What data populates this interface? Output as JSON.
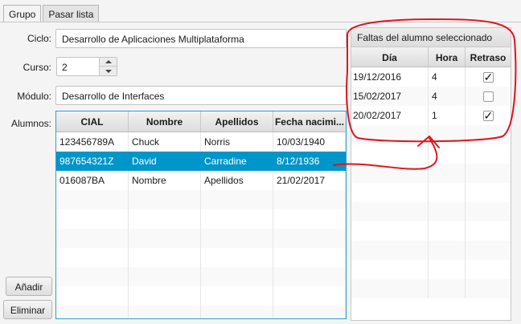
{
  "tabs": [
    {
      "label": "Grupo",
      "active": true
    },
    {
      "label": "Pasar lista",
      "active": false
    }
  ],
  "form": {
    "ciclo_label": "Ciclo:",
    "ciclo_value": "Desarrollo de Aplicaciones Multiplataforma",
    "curso_label": "Curso:",
    "curso_value": "2",
    "modulo_label": "Módulo:",
    "modulo_value": "Desarrollo de Interfaces",
    "alumnos_label": "Alumnos:"
  },
  "buttons": {
    "add": "Añadir",
    "delete": "Eliminar"
  },
  "alumnos_table": {
    "columns": [
      "CIAL",
      "Nombre",
      "Apellidos",
      "Fecha nacimi..."
    ],
    "rows": [
      [
        "123456789A",
        "Chuck",
        "Norris",
        "10/03/1940"
      ],
      [
        "987654321Z",
        "David",
        "Carradine",
        "8/12/1936"
      ],
      [
        "016087BA",
        "Nombre",
        "Apellidos",
        "21/02/2017"
      ]
    ],
    "selected_row": 1
  },
  "faltas": {
    "title": "Faltas del alumno seleccionado",
    "columns": [
      "Día",
      "Hora",
      "Retraso"
    ],
    "rows": [
      {
        "dia": "19/12/2016",
        "hora": "4",
        "retraso": true
      },
      {
        "dia": "15/02/2017",
        "hora": "4",
        "retraso": false
      },
      {
        "dia": "20/02/2017",
        "hora": "1",
        "retraso": true
      }
    ]
  },
  "colors": {
    "selection": "#0096c9",
    "focus_border": "#2a9fd6",
    "annotation": "#e0141e"
  }
}
